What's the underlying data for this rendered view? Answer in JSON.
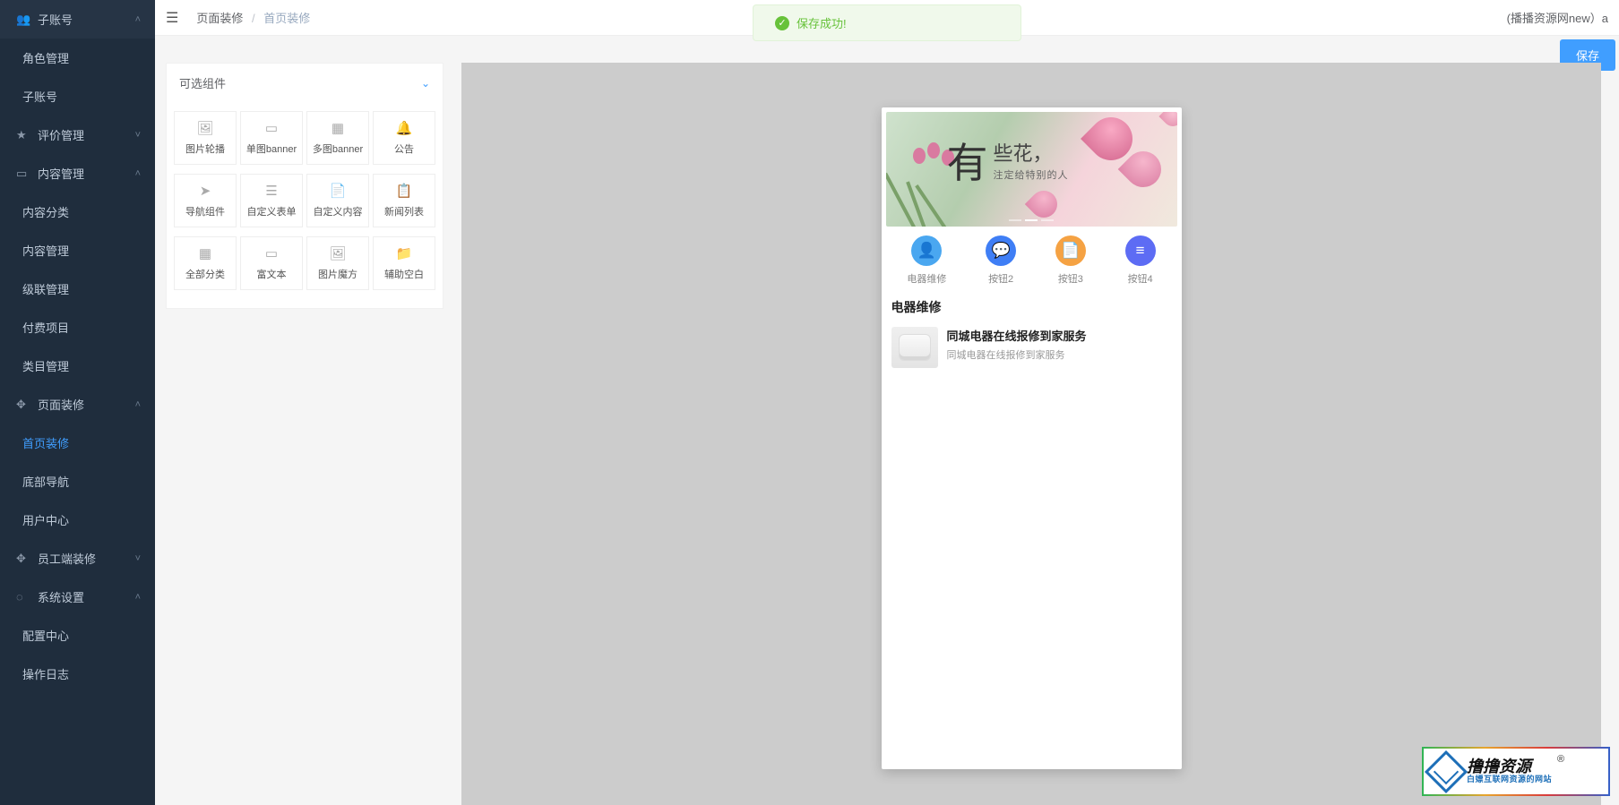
{
  "sidebar": {
    "sections": [
      {
        "title": "子账号",
        "icon": "👥",
        "open": true,
        "items": [
          {
            "label": "角色管理"
          },
          {
            "label": "子账号"
          }
        ]
      },
      {
        "title": "评价管理",
        "icon": "★",
        "open": false,
        "items": []
      },
      {
        "title": "内容管理",
        "icon": "▭",
        "open": true,
        "items": [
          {
            "label": "内容分类"
          },
          {
            "label": "内容管理"
          },
          {
            "label": "级联管理"
          },
          {
            "label": "付费项目"
          },
          {
            "label": "类目管理"
          }
        ]
      },
      {
        "title": "页面装修",
        "icon": "✥",
        "open": true,
        "items": [
          {
            "label": "首页装修",
            "active": true
          },
          {
            "label": "底部导航"
          },
          {
            "label": "用户中心"
          }
        ]
      },
      {
        "title": "员工端装修",
        "icon": "✥",
        "open": false,
        "items": []
      },
      {
        "title": "系统设置",
        "icon": "◌",
        "open": true,
        "items": [
          {
            "label": "配置中心"
          },
          {
            "label": "操作日志"
          }
        ]
      }
    ]
  },
  "topbar": {
    "breadcrumb_root": "页面装修",
    "breadcrumb_current": "首页装修",
    "user_text": "(播播资源网new）a"
  },
  "toast": {
    "text": "保存成功!"
  },
  "actions": {
    "save_label": "保存"
  },
  "palette": {
    "title": "可选组件",
    "items": [
      {
        "key": "carousel",
        "icon": "🖼",
        "label": "图片轮播"
      },
      {
        "key": "single-banner",
        "icon": "▭",
        "label": "单图banner"
      },
      {
        "key": "multi-banner",
        "icon": "▦",
        "label": "多图banner"
      },
      {
        "key": "notice",
        "icon": "🔔",
        "label": "公告"
      },
      {
        "key": "nav",
        "icon": "➤",
        "label": "导航组件"
      },
      {
        "key": "custom-form",
        "icon": "☰",
        "label": "自定义表单"
      },
      {
        "key": "custom-content",
        "icon": "📄",
        "label": "自定义内容"
      },
      {
        "key": "news-list",
        "icon": "📋",
        "label": "新闻列表"
      },
      {
        "key": "all-cat",
        "icon": "▦",
        "label": "全部分类"
      },
      {
        "key": "richtext",
        "icon": "▭",
        "label": "富文本"
      },
      {
        "key": "image-magic",
        "icon": "🖼",
        "label": "图片魔方"
      },
      {
        "key": "spacer",
        "icon": "📁",
        "label": "辅助空白"
      }
    ]
  },
  "preview": {
    "banner": {
      "char": "有",
      "text1": "些花，",
      "text2": "注定给特别的人"
    },
    "nav_buttons": [
      {
        "label": "电器维修",
        "icon": "👤",
        "color": "#4aa7f0"
      },
      {
        "label": "按钮2",
        "icon": "💬",
        "color": "#3f7ef5"
      },
      {
        "label": "按钮3",
        "icon": "📄",
        "color": "#f5a243"
      },
      {
        "label": "按钮4",
        "icon": "≡",
        "color": "#5d6cf4"
      }
    ],
    "section_title": "电器维修",
    "list": [
      {
        "title": "同城电器在线报修到家服务",
        "sub": "同城电器在线报修到家服务"
      }
    ]
  },
  "watermark": {
    "main": "撸撸资源",
    "sub": "白嫖互联网资源的网站",
    "reg": "®"
  }
}
